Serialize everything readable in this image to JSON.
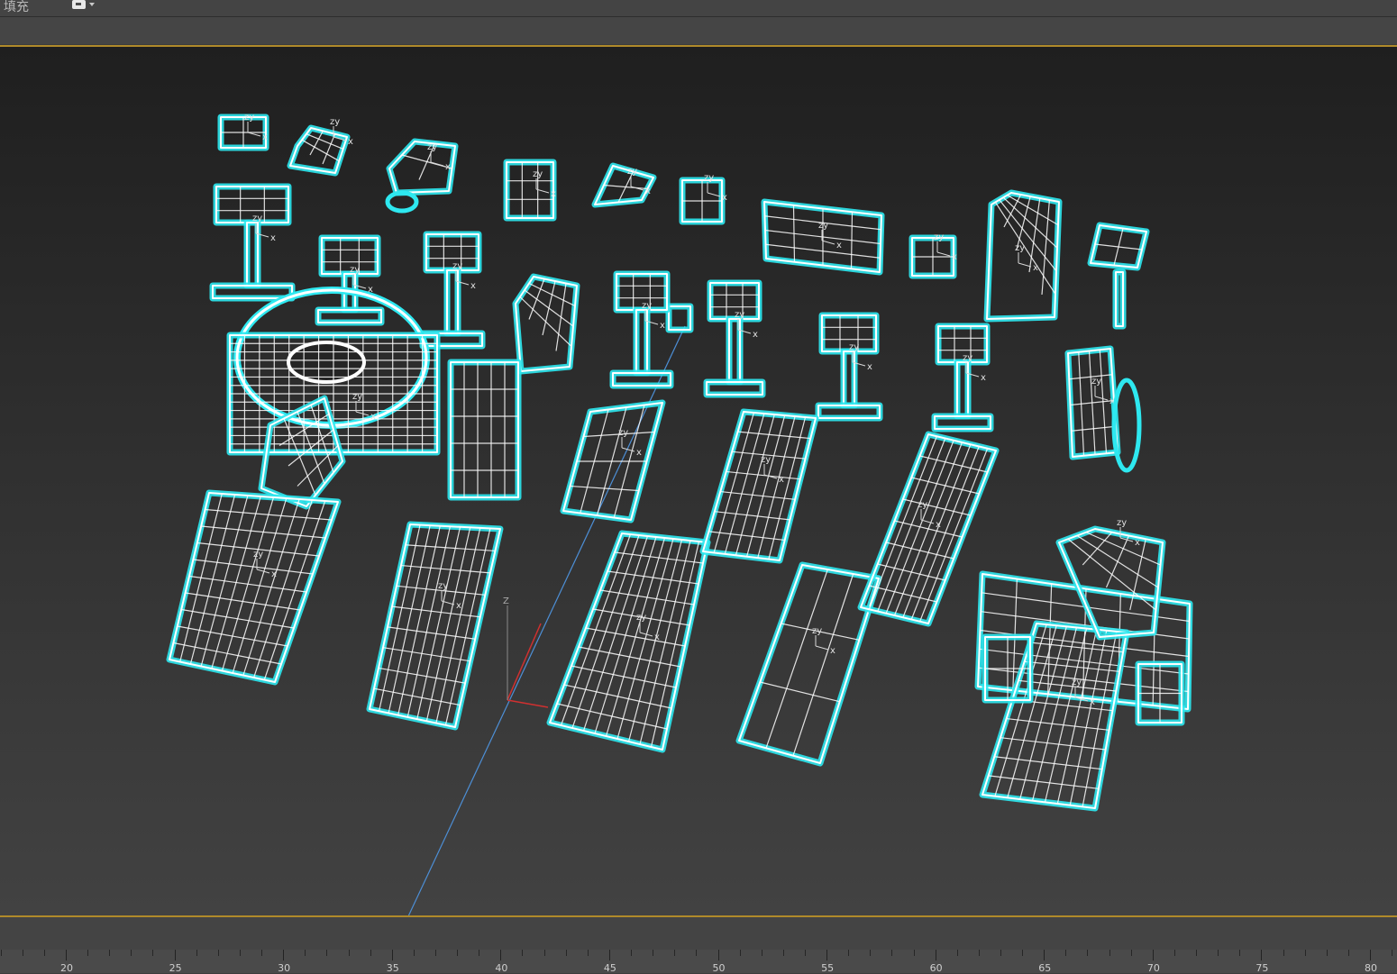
{
  "toolbar": {
    "fill_label": "填充",
    "fill_dropdown_icon": "fill-swatch-icon"
  },
  "viewport": {
    "wire_color": "#2ee8f0",
    "core_color": "#ffffff",
    "frame_color": "#b08a2a",
    "axis_label_y": "Z",
    "gizmo_labels": [
      "z",
      "y",
      "x"
    ]
  },
  "timeline": {
    "labels": [
      "20",
      "25",
      "30",
      "35",
      "40",
      "45",
      "50",
      "55",
      "60",
      "65",
      "70",
      "75",
      "80"
    ]
  }
}
